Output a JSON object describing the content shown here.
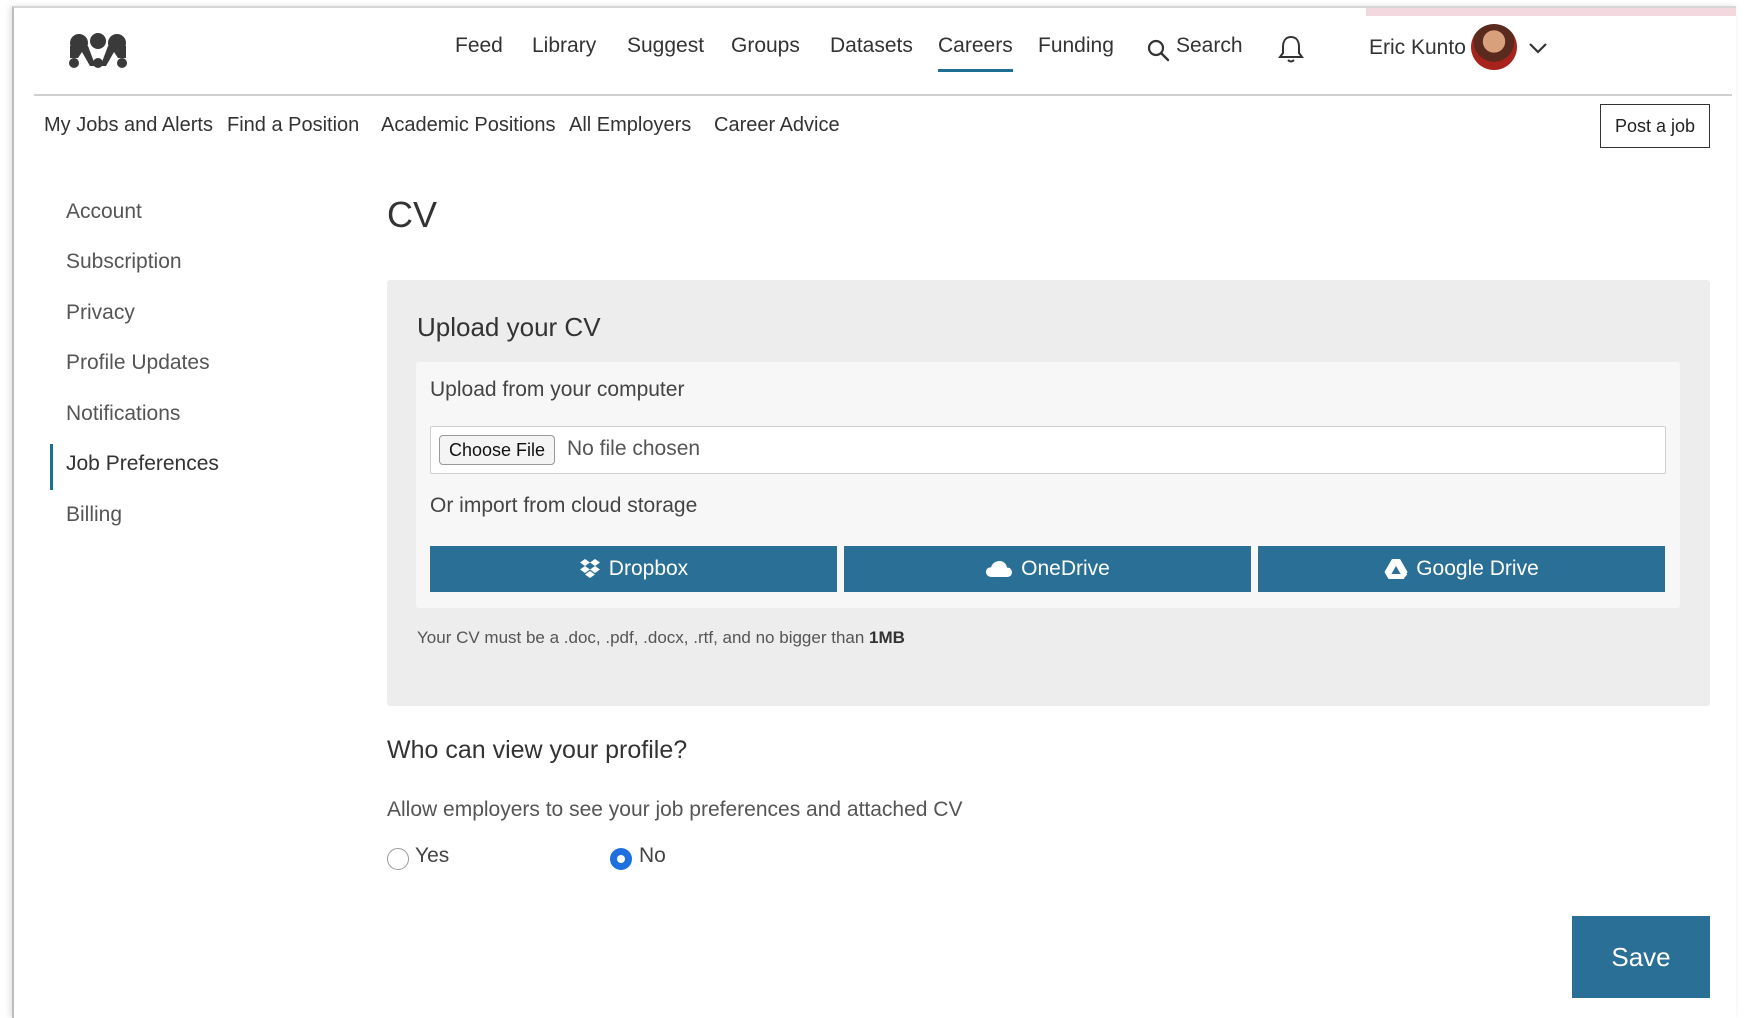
{
  "topnav": {
    "items": [
      {
        "label": "Feed"
      },
      {
        "label": "Library"
      },
      {
        "label": "Suggest"
      },
      {
        "label": "Groups"
      },
      {
        "label": "Datasets"
      },
      {
        "label": "Careers",
        "active": true
      },
      {
        "label": "Funding"
      }
    ],
    "search_label": "Search",
    "user_name": "Eric Kunto"
  },
  "subnav": {
    "items": [
      {
        "label": "My Jobs and Alerts"
      },
      {
        "label": "Find a Position"
      },
      {
        "label": "Academic Positions"
      },
      {
        "label": "All Employers"
      },
      {
        "label": "Career Advice"
      }
    ],
    "post_job_label": "Post a job"
  },
  "sidebar": {
    "items": [
      {
        "label": "Account"
      },
      {
        "label": "Subscription"
      },
      {
        "label": "Privacy"
      },
      {
        "label": "Profile Updates"
      },
      {
        "label": "Notifications"
      },
      {
        "label": "Job Preferences",
        "active": true
      },
      {
        "label": "Billing"
      }
    ]
  },
  "main": {
    "title": "CV",
    "upload": {
      "title": "Upload your CV",
      "computer_label": "Upload from your computer",
      "choose_file_label": "Choose File",
      "no_file_label": "No file chosen",
      "cloud_label": "Or import from cloud storage",
      "cloud_buttons": [
        {
          "label": "Dropbox",
          "icon": "dropbox-icon"
        },
        {
          "label": "OneDrive",
          "icon": "onedrive-icon"
        },
        {
          "label": "Google Drive",
          "icon": "google-drive-icon"
        }
      ],
      "hint_text": "Your CV must be a .doc, .pdf, .docx, .rtf, and no bigger than",
      "hint_size": "1MB"
    },
    "visibility": {
      "title": "Who can view your profile?",
      "description": "Allow employers to see your job preferences and attached CV",
      "options": [
        {
          "label": "Yes",
          "selected": false
        },
        {
          "label": "No",
          "selected": true
        }
      ]
    },
    "save_label": "Save"
  },
  "colors": {
    "accent": "#2a6f96",
    "radio_selected": "#1e6fe0"
  }
}
